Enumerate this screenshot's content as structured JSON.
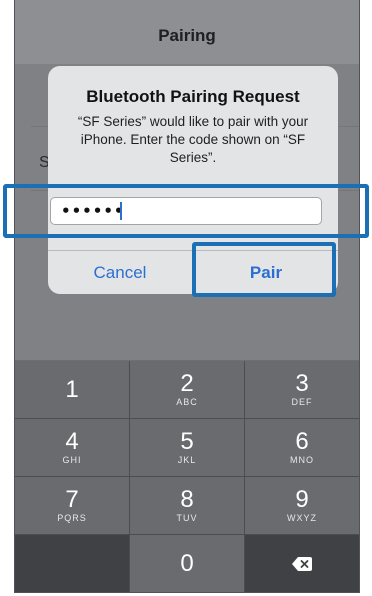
{
  "screen": {
    "nav_title": "Pairing",
    "background_list_letter": "S"
  },
  "alert": {
    "title": "Bluetooth Pairing Request",
    "message": "“SF Series” would like to pair with your iPhone. Enter the code shown on “SF Series”.",
    "input_value": "••••••",
    "cancel_label": "Cancel",
    "pair_label": "Pair"
  },
  "keypad": {
    "keys": [
      {
        "digit": "1",
        "letters": ""
      },
      {
        "digit": "2",
        "letters": "ABC"
      },
      {
        "digit": "3",
        "letters": "DEF"
      },
      {
        "digit": "4",
        "letters": "GHI"
      },
      {
        "digit": "5",
        "letters": "JKL"
      },
      {
        "digit": "6",
        "letters": "MNO"
      },
      {
        "digit": "7",
        "letters": "PQRS"
      },
      {
        "digit": "8",
        "letters": "TUV"
      },
      {
        "digit": "9",
        "letters": "WXYZ"
      },
      {
        "digit": "0",
        "letters": ""
      }
    ],
    "delete_icon": "backspace-icon"
  },
  "colors": {
    "accent": "#2c6fd1",
    "highlight": "#1a6fb5",
    "keypad_light": "#696b6f",
    "keypad_dark": "#3f4144"
  }
}
